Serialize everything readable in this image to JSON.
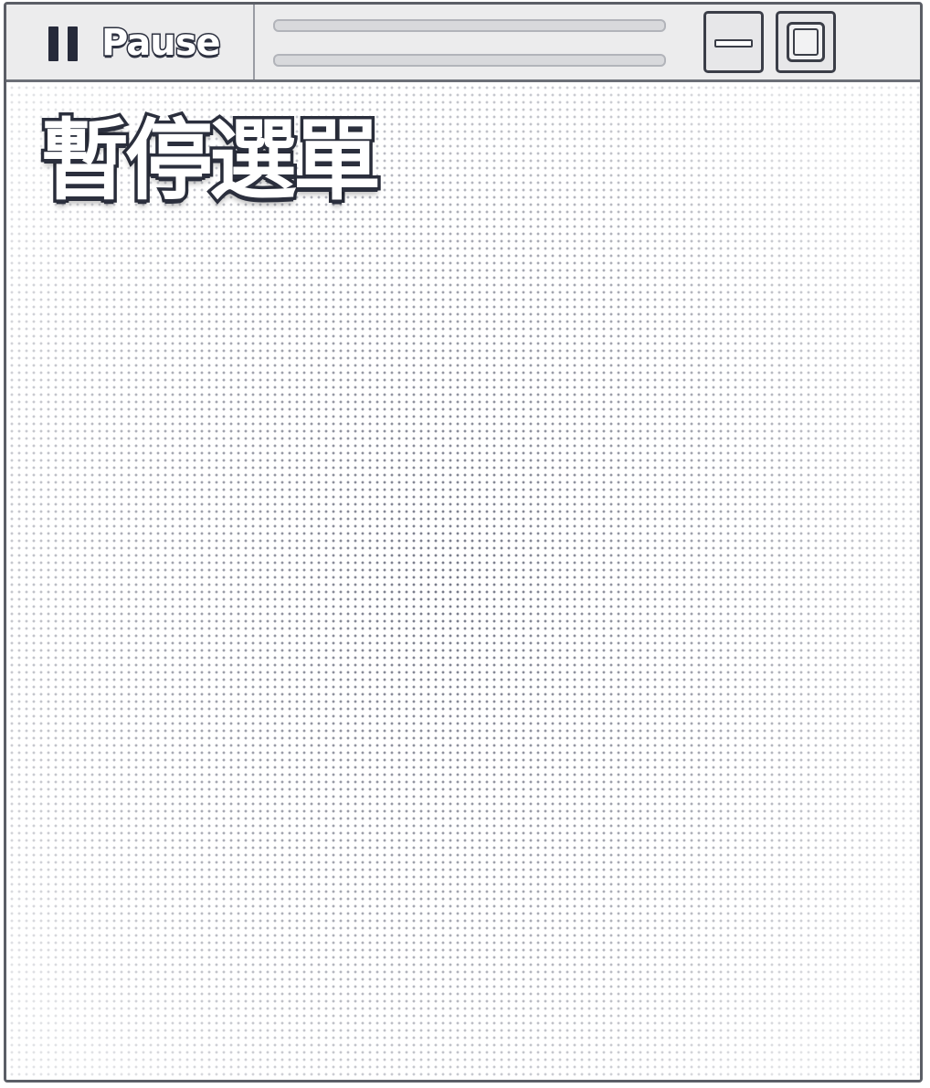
{
  "titlebar": {
    "tab_label": "Pause",
    "tab_icon": "pause-icon",
    "minimize_icon": "minimize-icon",
    "maximize_icon": "maximize-icon"
  },
  "menu": {
    "title": "暫停選單"
  },
  "colors": {
    "ink": "#2b2f3d",
    "titlebar_bg": "#ececed",
    "frame": "#5b5e66"
  }
}
